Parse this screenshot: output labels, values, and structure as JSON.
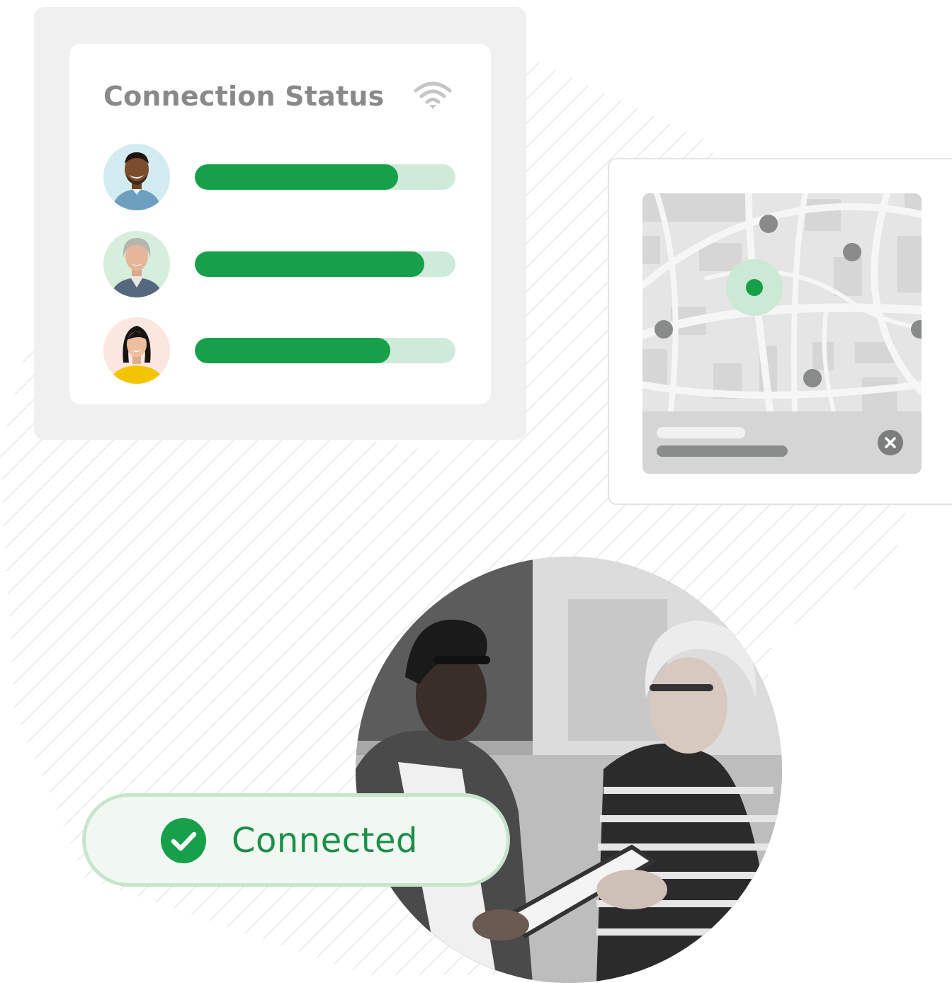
{
  "status_card": {
    "title": "Connection Status",
    "icon": "wifi-icon",
    "users": [
      {
        "avatar": "avatar-man-smiling",
        "connection_fraction": 0.78
      },
      {
        "avatar": "avatar-woman-gray-hair",
        "connection_fraction": 0.88
      },
      {
        "avatar": "avatar-woman-yellow-top",
        "connection_fraction": 0.75
      }
    ]
  },
  "map_card": {
    "icon": "close-icon"
  },
  "connected_badge": {
    "label": "Connected",
    "icon": "check-circle-icon"
  },
  "colors": {
    "accent_green": "#17a049",
    "track_green": "#cfeadb",
    "pill_text": "#1c8f48",
    "title_gray": "#878a88"
  }
}
